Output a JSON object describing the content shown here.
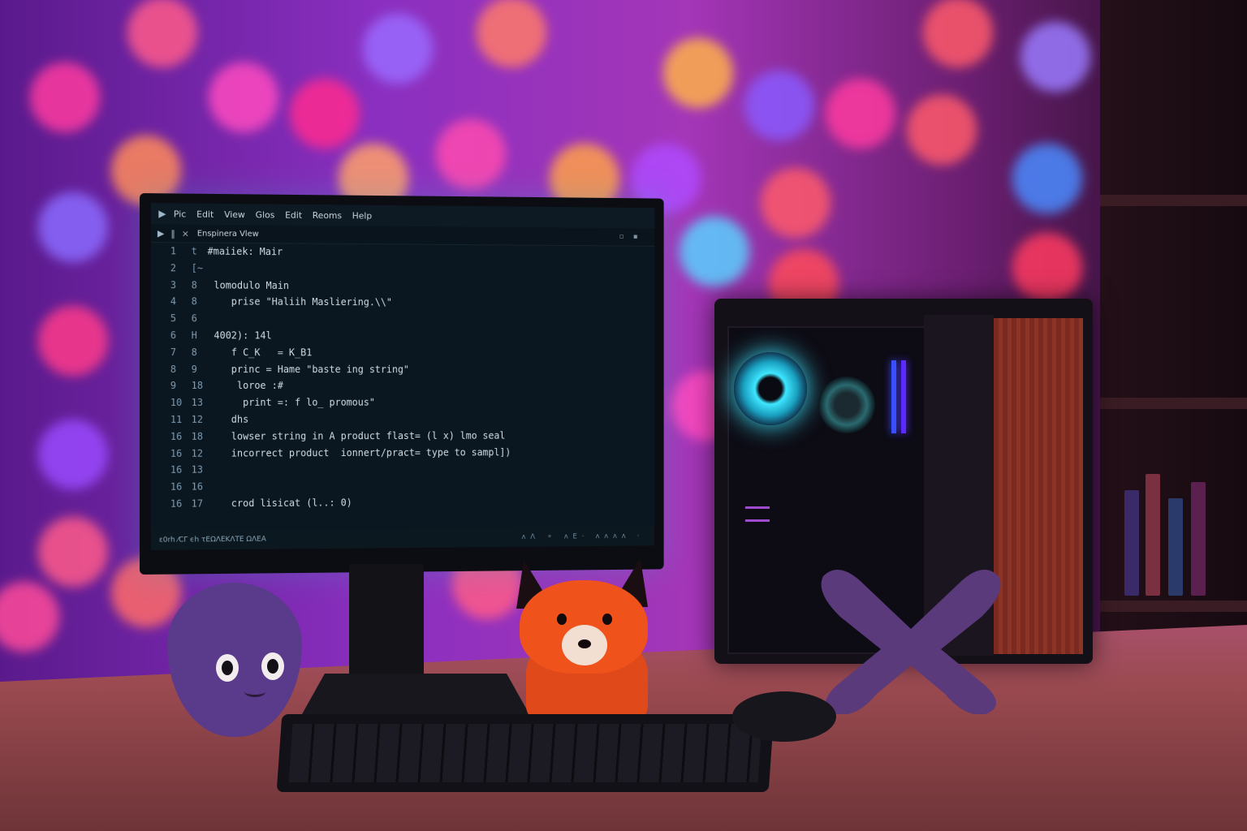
{
  "editor": {
    "menu": [
      "Pic",
      "Edit",
      "View",
      "Glos",
      "Edit",
      "Reoms",
      "Help"
    ],
    "tab_title": "Enspinera Vlew",
    "status_left": "ε0rh ⁄CΓ ϵh τΕΩΛΕΚΛΤΕ ΩΛΕΑ",
    "status_right": "ᴧΛ ⚬ ᴧΕ· ᴧᴧᴧᴧ ·",
    "lines": [
      {
        "n1": "1",
        "n2": "t",
        "text": "#maiiek: Mair"
      },
      {
        "n1": "2",
        "n2": "[~",
        "text": ""
      },
      {
        "n1": "3",
        "n2": "8",
        "text": "lomodulo Main"
      },
      {
        "n1": "4",
        "n2": "8",
        "text": "   prise \"Haliih Masliering.\\\\\""
      },
      {
        "n1": "5",
        "n2": "6",
        "text": ""
      },
      {
        "n1": "6",
        "n2": "H",
        "text": "4002): 14l"
      },
      {
        "n1": "7",
        "n2": "8",
        "text": "   f C_K   = K_B1"
      },
      {
        "n1": "8",
        "n2": "9",
        "text": "   princ = Hame \"baste ing string\""
      },
      {
        "n1": "9",
        "n2": "18",
        "text": "    loroe :#"
      },
      {
        "n1": "10",
        "n2": "13",
        "text": "     print =: f lo_ promous\""
      },
      {
        "n1": "11",
        "n2": "12",
        "text": "   dhs"
      },
      {
        "n1": "16",
        "n2": "18",
        "text": "   lowser string in A product flast= (l x) lmo seal"
      },
      {
        "n1": "16",
        "n2": "12",
        "text": "   incorrect product  ionnert/pract= type to sampl])"
      },
      {
        "n1": "16",
        "n2": "13",
        "text": ""
      },
      {
        "n1": "16",
        "n2": "16",
        "text": ""
      },
      {
        "n1": "16",
        "n2": "17",
        "text": "   crod lisicat (l..: 0)"
      }
    ]
  },
  "colors": {
    "code_text": "#cfdde6",
    "accent_teal": "#5fd6e0",
    "fan_glow": "#3ee6ff",
    "fox": "#f0521c",
    "drop_plush": "#5a3a8a"
  }
}
